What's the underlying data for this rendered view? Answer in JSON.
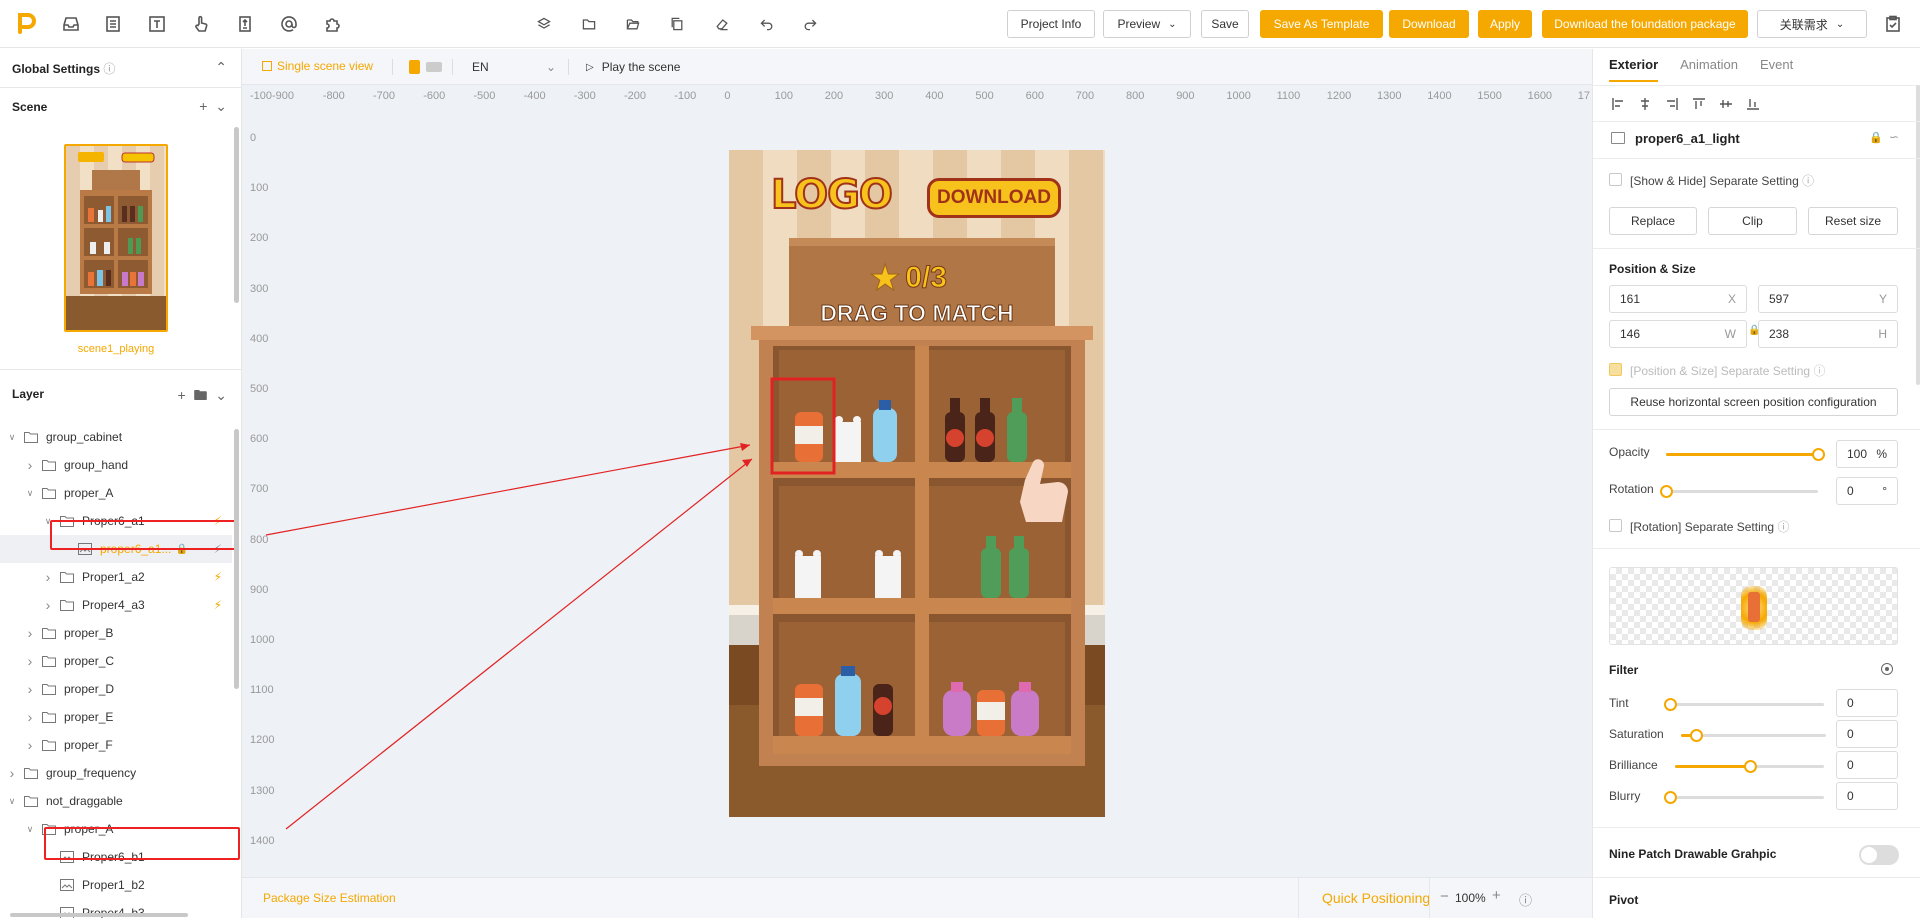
{
  "toolbar": {
    "buttons": {
      "project_info": "Project Info",
      "preview": "Preview",
      "save": "Save",
      "save_template": "Save As Template",
      "download": "Download",
      "apply": "Apply",
      "download_foundation": "Download the foundation package",
      "related": "关联需求"
    }
  },
  "left": {
    "global_settings": "Global Settings",
    "scene_title": "Scene",
    "scene_name": "scene1_playing",
    "layer_title": "Layer",
    "tree": [
      {
        "label": "group_cabinet",
        "depth": 0,
        "open": true,
        "type": "folder",
        "bolt": false
      },
      {
        "label": "group_hand",
        "depth": 1,
        "open": false,
        "type": "folder",
        "bolt": false
      },
      {
        "label": "proper_A",
        "depth": 1,
        "open": true,
        "type": "folder",
        "bolt": false
      },
      {
        "label": "Proper6_a1",
        "depth": 2,
        "open": true,
        "type": "folder",
        "bolt": true
      },
      {
        "label": "proper6_a1...",
        "depth": 3,
        "open": null,
        "type": "image",
        "bolt": true,
        "selected": true
      },
      {
        "label": "Proper1_a2",
        "depth": 2,
        "open": false,
        "type": "folder",
        "bolt": true
      },
      {
        "label": "Proper4_a3",
        "depth": 2,
        "open": false,
        "type": "folder",
        "bolt": true
      },
      {
        "label": "proper_B",
        "depth": 1,
        "open": false,
        "type": "folder",
        "bolt": false
      },
      {
        "label": "proper_C",
        "depth": 1,
        "open": false,
        "type": "folder",
        "bolt": false
      },
      {
        "label": "proper_D",
        "depth": 1,
        "open": false,
        "type": "folder",
        "bolt": false
      },
      {
        "label": "proper_E",
        "depth": 1,
        "open": false,
        "type": "folder",
        "bolt": false
      },
      {
        "label": "proper_F",
        "depth": 1,
        "open": false,
        "type": "folder",
        "bolt": false
      },
      {
        "label": "group_frequency",
        "depth": 0,
        "open": false,
        "type": "folder",
        "bolt": false
      },
      {
        "label": "not_draggable",
        "depth": 0,
        "open": true,
        "type": "folder",
        "bolt": false
      },
      {
        "label": "proper_A",
        "depth": 1,
        "open": true,
        "type": "folder",
        "bolt": false
      },
      {
        "label": "Proper6_b1",
        "depth": 2,
        "open": null,
        "type": "image",
        "bolt": false
      },
      {
        "label": "Proper1_b2",
        "depth": 2,
        "open": null,
        "type": "image",
        "bolt": false
      },
      {
        "label": "Proper4_b3",
        "depth": 2,
        "open": null,
        "type": "image",
        "bolt": false
      }
    ]
  },
  "canvas": {
    "single_scene": "Single scene view",
    "language": "EN",
    "play_scene": "Play the scene",
    "ruler_x": [
      "-100",
      "-900",
      "-800",
      "-700",
      "-600",
      "-500",
      "-400",
      "-300",
      "-200",
      "-100",
      "0",
      "100",
      "200",
      "300",
      "400",
      "500",
      "600",
      "700",
      "800",
      "900",
      "1000",
      "1100",
      "1200",
      "1300",
      "1400",
      "1500",
      "1600",
      "17"
    ],
    "ruler_y": [
      "0",
      "100",
      "200",
      "300",
      "400",
      "500",
      "600",
      "700",
      "800",
      "900",
      "1000",
      "1100",
      "1200",
      "1300",
      "1400"
    ],
    "package_size": "Package Size Estimation",
    "quick_positioning": "Quick Positioning",
    "zoom": "100%",
    "game": {
      "logo": "LOGO",
      "download": "DOWNLOAD",
      "score": "0/3",
      "instruction": "DRAG TO MATCH"
    }
  },
  "right": {
    "tabs": [
      "Exterior",
      "Animation",
      "Event"
    ],
    "layer_name": "proper6_a1_light",
    "show_hide": "[Show & Hide] Separate Setting",
    "replace": "Replace",
    "clip": "Clip",
    "reset_size": "Reset size",
    "pos_size_title": "Position & Size",
    "x": "161",
    "y": "597",
    "w": "146",
    "h": "238",
    "pos_separate": "[Position & Size] Separate Setting",
    "reuse": "Reuse horizontal screen position configuration",
    "opacity_label": "Opacity",
    "opacity": "100",
    "opacity_unit": "%",
    "rotation_label": "Rotation",
    "rotation": "0",
    "rotation_unit": "°",
    "rotation_separate": "[Rotation] Separate Setting",
    "filter_title": "Filter",
    "tint_label": "Tint",
    "tint": "0",
    "saturation_label": "Saturation",
    "saturation": "0",
    "brilliance_label": "Brilliance",
    "brilliance": "0",
    "blurry_label": "Blurry",
    "blurry": "0",
    "nine_patch": "Nine Patch Drawable Grahpic",
    "pivot": "Pivot",
    "levels": {
      "opacity": 1.0,
      "rotation": 0.0,
      "tint": 0.0,
      "saturation": 0.1,
      "brilliance": 0.5,
      "blurry": 0.0
    }
  },
  "colors": {
    "accent": "#f5a800",
    "highlight": "#e22222"
  }
}
